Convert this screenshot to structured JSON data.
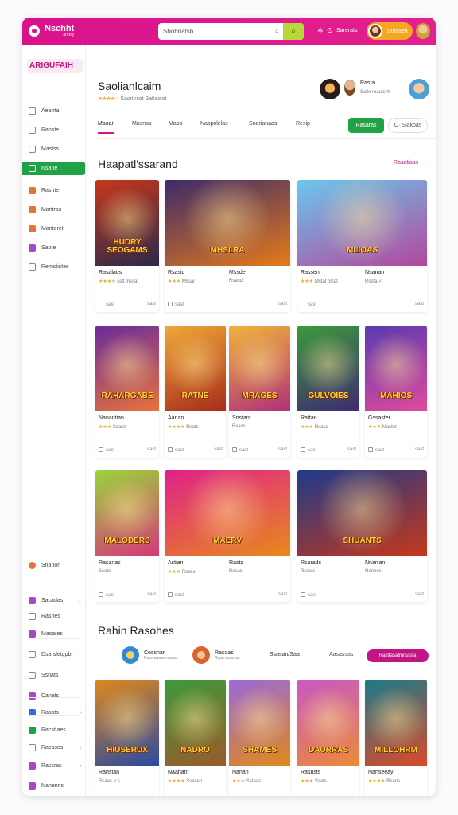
{
  "topbar": {
    "brand": "Nschht",
    "brand_sub": "arenty",
    "search_value": "Sbobriatsb",
    "notify_label": "Sarerats",
    "user_label": "Stosaeh"
  },
  "sidebar": {
    "title": "ARIGUFAIH",
    "items": [
      {
        "label": "Aeatrta",
        "icon": "home-icon"
      },
      {
        "label": "Ranste",
        "icon": "grid-icon"
      },
      {
        "label": "Mastss",
        "icon": "users-icon"
      },
      {
        "label": "Nsane",
        "icon": "gamepad-icon",
        "active": true
      },
      {
        "label": "Rasnte",
        "icon": "star-icon",
        "color": "#e8733a"
      },
      {
        "label": "Mantras",
        "icon": "flame-icon",
        "color": "#e8733a"
      },
      {
        "label": "Manteret",
        "icon": "trophy-icon",
        "color": "#e8733a"
      },
      {
        "label": "Saote",
        "icon": "box-icon",
        "color": "#a44bc4"
      },
      {
        "label": "Remstistes",
        "icon": "settings-icon"
      }
    ],
    "lower_items": [
      {
        "label": "Snanon",
        "icon": "dot-icon",
        "color": "#e8733a"
      },
      {
        "label": "Sacadas",
        "icon": "inbox-icon",
        "color": "#a44bc4",
        "chevron": "⌄"
      },
      {
        "label": "Rasnes",
        "icon": "bars-icon"
      },
      {
        "label": "Masares",
        "icon": "clock-icon",
        "color": "#a44bc4"
      },
      {
        "label": "Dsarsletgpbt",
        "icon": "link-icon"
      },
      {
        "label": "Ssnats",
        "icon": "calendar-icon"
      },
      {
        "label": "Canats",
        "icon": "chat-icon",
        "color": "#a44bc4"
      },
      {
        "label": "Rasats",
        "icon": "mail-icon",
        "color": "#3a6ad9",
        "chevron": "›"
      },
      {
        "label": "Racstlaes",
        "icon": "leaf-icon",
        "color": "#21a345"
      },
      {
        "label": "Racases",
        "icon": "tag-icon",
        "chevron": "›"
      },
      {
        "label": "Racsras",
        "icon": "flag-icon",
        "color": "#a44bc4",
        "chevron": "›"
      },
      {
        "label": "Nanenris",
        "icon": "plus-icon",
        "color": "#a44bc4"
      }
    ]
  },
  "header": {
    "title": "Saolianlcaim",
    "stars": "★★★★☆",
    "sub": "Saoit riiot Satlaisot",
    "profile_name": "Rasta",
    "profile_meta": "Salle roauts  ✉",
    "tabs": [
      "Maoan",
      "Masnas",
      "Mabs",
      "Naspolelas",
      "Soarianaas",
      "Resip"
    ],
    "green_btn": "Rasaras",
    "outline_btn": "O·  Slakoas"
  },
  "featured": {
    "title": "Haapatl'ssarand",
    "link": "Rasatiaas",
    "cards": [
      {
        "title": "Rasalaos",
        "stars": "★★★★",
        "meta": "sstt  mssat",
        "left": "sast",
        "right": "sast",
        "img": "HUDRY SEOGAMS",
        "bg": "#c7371a,#2a2a4a"
      },
      {
        "title": "Rsasid",
        "stars": "★★★",
        "meta": "Mssar",
        "left": "sast",
        "right": "sast",
        "img": "MHSLRA",
        "bg": "#3c2a6a,#e57a1a"
      },
      {
        "title": "Mssde",
        "stars": "",
        "meta": "Rsasd",
        "left": "sast",
        "right": "sast",
        "img": "",
        "bg": "#e0881b,#7a2a80"
      },
      {
        "title": "Rassen",
        "stars": "★★★",
        "meta": "Mstat tistat",
        "left": "sast",
        "right": "sast",
        "img": "MLIOAS",
        "bg": "#6ac8ef,#b3479c"
      },
      {
        "title": "Nsanan",
        "stars": "★★",
        "meta": "Rssta  ✓",
        "left": "sast",
        "right": "sast",
        "img": "",
        "bg": "#6ac8ef,#ef9a3a"
      },
      {
        "title": "Nanantian",
        "stars": "★★★",
        "meta": "Ssarst",
        "left": "sast",
        "right": "sast",
        "img": "RAHARGABE",
        "bg": "#6a2b9c,#e8733a"
      },
      {
        "title": "Aanan",
        "stars": "★★★★",
        "meta": "Rsats",
        "left": "sast",
        "right": "sast",
        "img": "RATNE",
        "bg": "#f0a838,#a62b1a"
      },
      {
        "title": "Snstant",
        "stars": "",
        "meta": "Rsass",
        "left": "sast",
        "right": "sast",
        "img": "MRAGES",
        "bg": "#f0b43a,#b0307a"
      },
      {
        "title": "Rattan",
        "stars": "★★★",
        "meta": "Rsass",
        "left": "sast",
        "right": "sast",
        "img": "GULVOIES",
        "bg": "#3c9a3c,#3f2a70"
      },
      {
        "title": "Gssaster",
        "stars": "★★★",
        "meta": "Mastst",
        "left": "sast",
        "right": "sast",
        "img": "MAHIOS",
        "bg": "#5a3ab0,#e04b9c"
      },
      {
        "title": "Rasanas",
        "stars": "",
        "meta": "Ssate",
        "left": "sast",
        "right": "sast",
        "img": "MALODERS",
        "bg": "#9ad43a,#d6367a"
      },
      {
        "title": "Astian",
        "stars": "★★★",
        "meta": "Rssas",
        "left": "sast",
        "right": "sast",
        "img": "MAERV",
        "bg": "#e0208a,#e88a1a"
      },
      {
        "title": "Rasta",
        "stars": "★★★",
        "meta": "Rssas",
        "left": "sast",
        "right": "sast",
        "img": "",
        "bg": "#6ac8ef,#2a8ad9"
      },
      {
        "title": "Rsaradc",
        "stars": "",
        "meta": "Rssats",
        "left": "sast",
        "right": "sast",
        "img": "SHUANTS",
        "bg": "#1d3a8a,#c7371a"
      },
      {
        "title": "Nnarran",
        "stars": "★★★",
        "meta": "Nanees",
        "left": "sast",
        "right": "sast",
        "img": "",
        "bg": "#7a5ac9,#ea6a3a"
      }
    ]
  },
  "recent": {
    "title": "Rahin Rasohes",
    "channels": [
      {
        "name": "Cossnar",
        "sub": "Rsso aaaas raasss",
        "color": "#2e8ad9"
      },
      {
        "name": "Rasoas",
        "sub": "Rsaa asaa  ias",
        "color": "#d9652e"
      }
    ],
    "meta1": "Ssnsan/Saa",
    "meta2": "Aasassas",
    "follow_btn": "Rasttasatmrsasta",
    "cards": [
      {
        "title": "Ranstan",
        "stars": "",
        "meta": "Rsaas  ✓s",
        "left": "sast",
        "right": "sast",
        "img": "HIUSERUX",
        "bg": "#e0881b,#2a4aa0"
      },
      {
        "title": "Naahant",
        "stars": "★★★★",
        "meta": "Ssasen",
        "left": "sast",
        "right": "sast",
        "img": "NADRO",
        "bg": "#3c9a3c,#9a5a2a"
      },
      {
        "title": "Nanan",
        "stars": "★★★",
        "meta": "Sstaas",
        "left": "sast",
        "right": "sast",
        "img": "SHAMES",
        "bg": "#9a6ad9,#e0881b"
      },
      {
        "title": "Rasnsts",
        "stars": "★★★",
        "meta": "Ssats",
        "left": "sast",
        "right": "sast",
        "img": "DAURRAS",
        "bg": "#c957c4,#ea8a3a"
      },
      {
        "title": "Nanseeay",
        "stars": "★★★★",
        "meta": "Rsans",
        "left": "sast",
        "right": "sast",
        "img": "MILLOHRM",
        "bg": "#1d7a8a,#d94a2a"
      }
    ]
  },
  "colors": {
    "accent": "#d9128c",
    "green": "#21a345",
    "orange": "#f6a623"
  }
}
